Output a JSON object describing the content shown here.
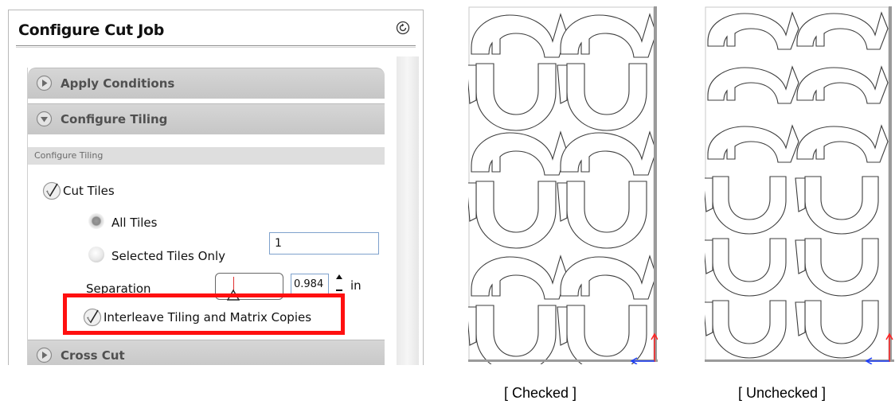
{
  "panel": {
    "title": "Configure Cut Job",
    "sections": {
      "apply_conditions": "Apply Conditions",
      "configure_tiling": "Configure Tiling",
      "configure_tiling_sub": "Configure Tiling",
      "cross_cut": "Cross Cut"
    },
    "cut_tiles": {
      "label": "Cut Tiles",
      "checked": true
    },
    "tile_mode": {
      "all_tiles_label": "All Tiles",
      "selected_only_label": "Selected Tiles Only",
      "selected": "All Tiles",
      "selected_tiles_value": "1"
    },
    "separation": {
      "label": "Separation",
      "value": "0.984",
      "unit": "in"
    },
    "interleave": {
      "label": "Interleave Tiling and Matrix Copies",
      "checked": true
    }
  },
  "previews": {
    "checked_caption": "[ Checked ]",
    "unchecked_caption": "[ Unchecked ]"
  },
  "colors": {
    "highlight": "#ff1010",
    "section_header": "#cccccc",
    "axis_x": "#1a3cff",
    "axis_y": "#ff2020"
  },
  "icons": {
    "reset": "reset-icon",
    "expand": "expand-arrow-icon",
    "collapse": "collapse-arrow-icon",
    "check": "checkmark-icon"
  }
}
